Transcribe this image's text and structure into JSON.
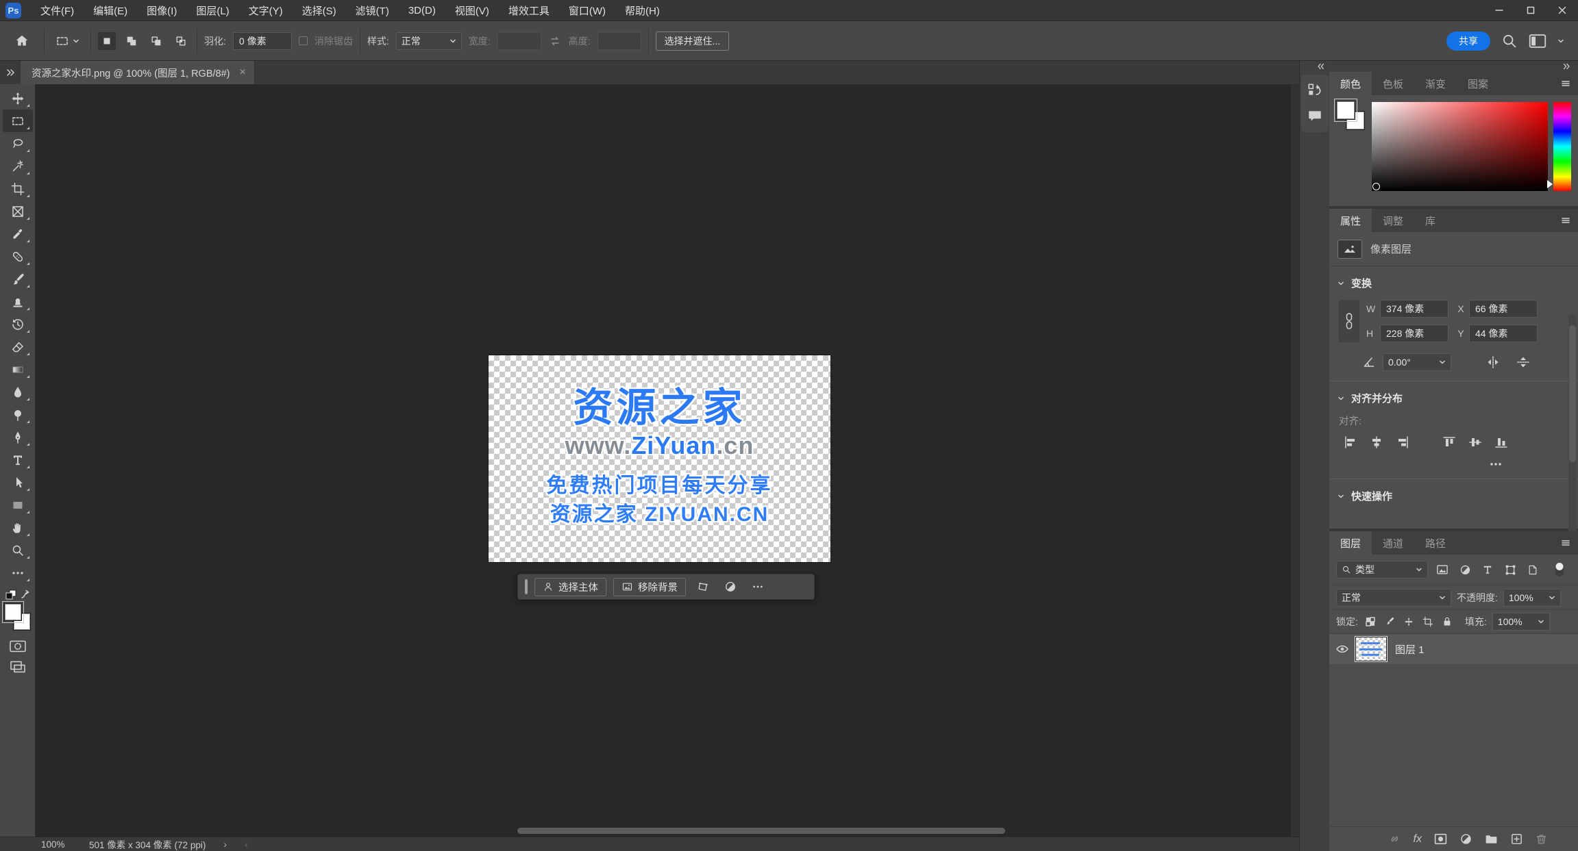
{
  "window": {
    "logo_text": "Ps"
  },
  "menu": {
    "items": [
      "文件(F)",
      "编辑(E)",
      "图像(I)",
      "图层(L)",
      "文字(Y)",
      "选择(S)",
      "滤镜(T)",
      "3D(D)",
      "视图(V)",
      "增效工具",
      "窗口(W)",
      "帮助(H)"
    ]
  },
  "options": {
    "feather_label": "羽化:",
    "feather_value": "0 像素",
    "antialias_label": "消除锯齿",
    "style_label": "样式:",
    "style_value": "正常",
    "width_label": "宽度:",
    "width_value": "",
    "height_label": "高度:",
    "height_value": "",
    "select_mask_label": "选择并遮住...",
    "share_label": "共享"
  },
  "tabbar": {
    "doc_title": "资源之家水印.png @ 100% (图层 1, RGB/8#)",
    "close_glyph": "×"
  },
  "toolbar": {
    "tools": [
      "move",
      "rectangular-marquee",
      "lasso",
      "object-selection",
      "crop",
      "frame",
      "eyedropper",
      "spot-healing-brush",
      "brush",
      "clone-stamp",
      "history-brush",
      "eraser",
      "gradient",
      "blur",
      "dodge",
      "pen",
      "horizontal-type",
      "path-selection",
      "rectangle",
      "hand",
      "zoom",
      "edit-toolbar"
    ],
    "active_tool": "rectangular-marquee"
  },
  "canvas": {
    "watermark": {
      "title": "资源之家",
      "url_prefix": "www.",
      "url_main": "ZiYuan",
      "url_suffix": ".cn",
      "slogan": "免费热门项目每天分享",
      "footer": "资源之家 ZIYUAN.CN"
    },
    "taskbar": {
      "select_subject": "选择主体",
      "remove_bg": "移除背景"
    }
  },
  "dock": {
    "icons": [
      "history",
      "comment"
    ]
  },
  "color_panel": {
    "tabs": [
      "颜色",
      "色板",
      "渐变",
      "图案"
    ],
    "active_tab": "颜色"
  },
  "props_panel": {
    "tabs": [
      "属性",
      "调整",
      "库"
    ],
    "active_tab": "属性",
    "layer_type": "像素图层",
    "transform_title": "变换",
    "w_label": "W",
    "w_value": "374 像素",
    "x_label": "X",
    "x_value": "66 像素",
    "h_label": "H",
    "h_value": "228 像素",
    "y_label": "Y",
    "y_value": "44 像素",
    "angle_value": "0.00°",
    "align_title": "对齐并分布",
    "align_label": "对齐:",
    "quick_title": "快速操作"
  },
  "layers_panel": {
    "tabs": [
      "图层",
      "通道",
      "路径"
    ],
    "active_tab": "图层",
    "filter_value": "类型",
    "blend_value": "正常",
    "opacity_label": "不透明度:",
    "opacity_value": "100%",
    "lock_label": "锁定:",
    "fill_label": "填充:",
    "fill_value": "100%",
    "layer_name": "图层 1",
    "fx_label": "fx"
  },
  "statusbar": {
    "zoom_level": "100%",
    "doc_info": "501 像素 x 304 像素 (72 ppi)"
  },
  "colors": {
    "accent_blue": "#1473e6",
    "watermark_blue": "#2b7af3",
    "watermark_gray": "#868c93",
    "ps_logo_bg": "#2563c4",
    "canvas_bg": "#282828",
    "panel_bg": "#4e4e4e"
  }
}
